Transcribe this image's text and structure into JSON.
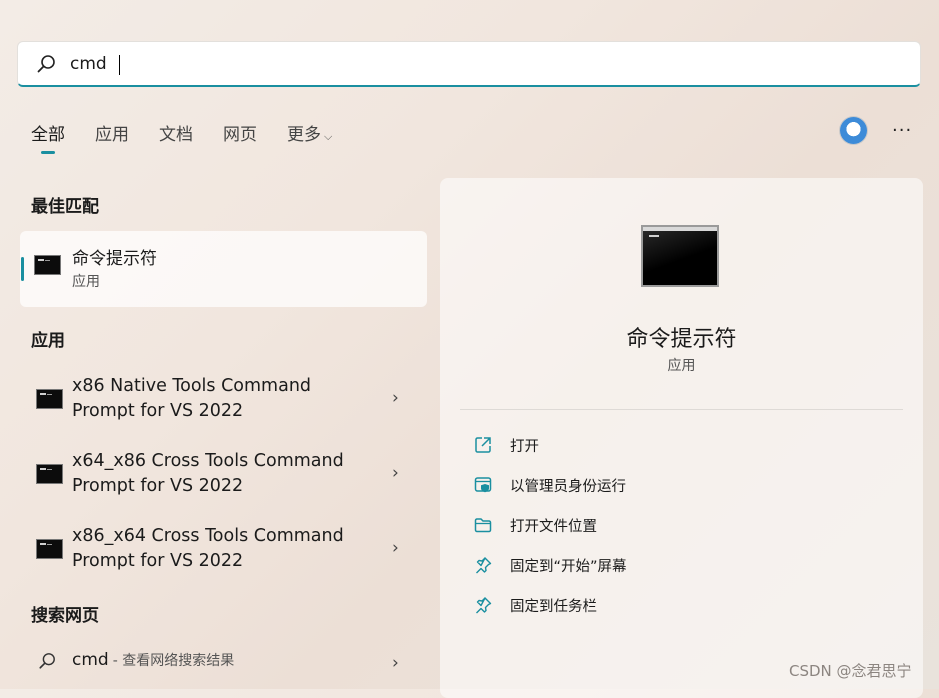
{
  "search": {
    "value": "cmd"
  },
  "tabs": [
    {
      "label": "全部"
    },
    {
      "label": "应用"
    },
    {
      "label": "文档"
    },
    {
      "label": "网页"
    },
    {
      "label": "更多"
    }
  ],
  "sections": {
    "best_match": "最佳匹配",
    "apps": "应用",
    "web": "搜索网页"
  },
  "best_match": {
    "title": "命令提示符",
    "subtitle": "应用"
  },
  "apps": [
    {
      "line1": "x86 Native Tools Command",
      "line2": "Prompt for VS 2022"
    },
    {
      "line1": "x64_x86 Cross Tools Command",
      "line2": "Prompt for VS 2022"
    },
    {
      "line1": "x86_x64 Cross Tools Command",
      "line2": "Prompt for VS 2022"
    }
  ],
  "web": {
    "query": "cmd",
    "suffix": "- 查看网络搜索结果"
  },
  "panel": {
    "title": "命令提示符",
    "subtitle": "应用",
    "actions": [
      {
        "label": "打开",
        "icon": "open-external-icon"
      },
      {
        "label": "以管理员身份运行",
        "icon": "shield-admin-icon"
      },
      {
        "label": "打开文件位置",
        "icon": "folder-icon"
      },
      {
        "label": "固定到“开始”屏幕",
        "icon": "pin-icon"
      },
      {
        "label": "固定到任务栏",
        "icon": "pin-icon"
      }
    ]
  },
  "watermark": "CSDN @念君思宁",
  "colors": {
    "accent": "#1a8fa0"
  }
}
